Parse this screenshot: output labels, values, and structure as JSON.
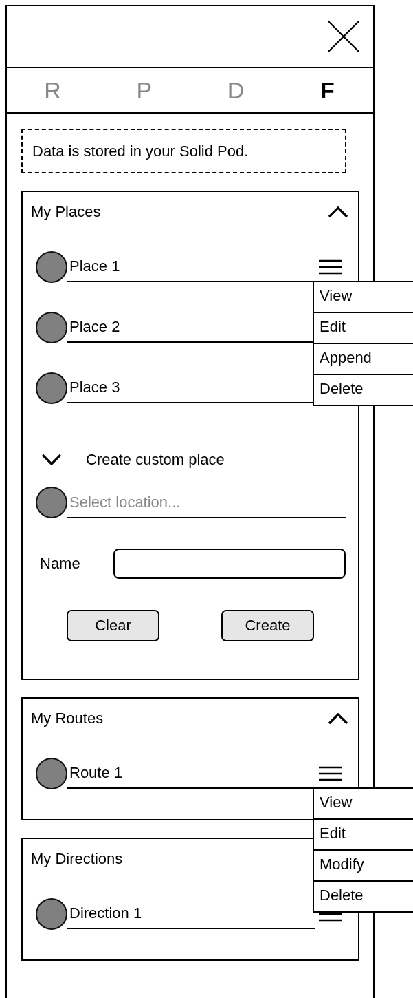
{
  "tabs": [
    {
      "label": "R",
      "selected": false
    },
    {
      "label": "P",
      "selected": false
    },
    {
      "label": "D",
      "selected": false
    },
    {
      "label": "F",
      "selected": true
    }
  ],
  "notice": "Data is stored in your Solid Pod.",
  "sections": [
    {
      "title": "My Places",
      "expanded": true,
      "items": [
        {
          "label": "Place 1",
          "menu_button": true,
          "menu": [
            "View",
            "Edit",
            "Append",
            "Delete"
          ]
        },
        {
          "label": "Place 2"
        },
        {
          "label": "Place 3"
        }
      ],
      "custom": {
        "title": "Create custom place",
        "location_placeholder": "Select location...",
        "name_label": "Name",
        "buttons": [
          "Clear",
          "Create"
        ]
      }
    },
    {
      "title": "My Routes",
      "expanded": true,
      "items": [
        {
          "label": "Route 1",
          "menu_button": true,
          "menu": [
            "View",
            "Edit",
            "Modify",
            "Delete"
          ]
        }
      ]
    },
    {
      "title": "My Directions",
      "items": [
        {
          "label": "Direction 1",
          "menu_button": true
        }
      ]
    }
  ]
}
